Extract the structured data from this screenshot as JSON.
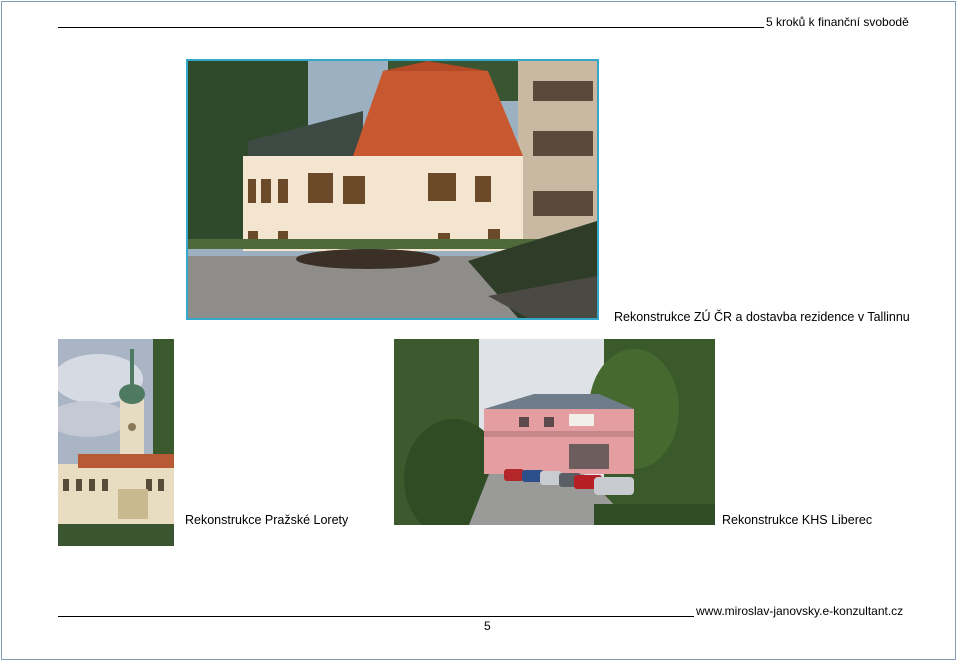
{
  "header": {
    "title": "5 kroků k finanční svobodě"
  },
  "photos": [
    {
      "caption": "Rekonstrukce ZÚ ČR a dostavba rezidence v Tallinnu"
    },
    {
      "caption": "Rekonstrukce  Pražské Lorety"
    },
    {
      "caption": "Rekonstrukce KHS Liberec"
    }
  ],
  "footer": {
    "url": "www.miroslav-janovsky.e-konzultant.cz",
    "page_number": "5"
  }
}
